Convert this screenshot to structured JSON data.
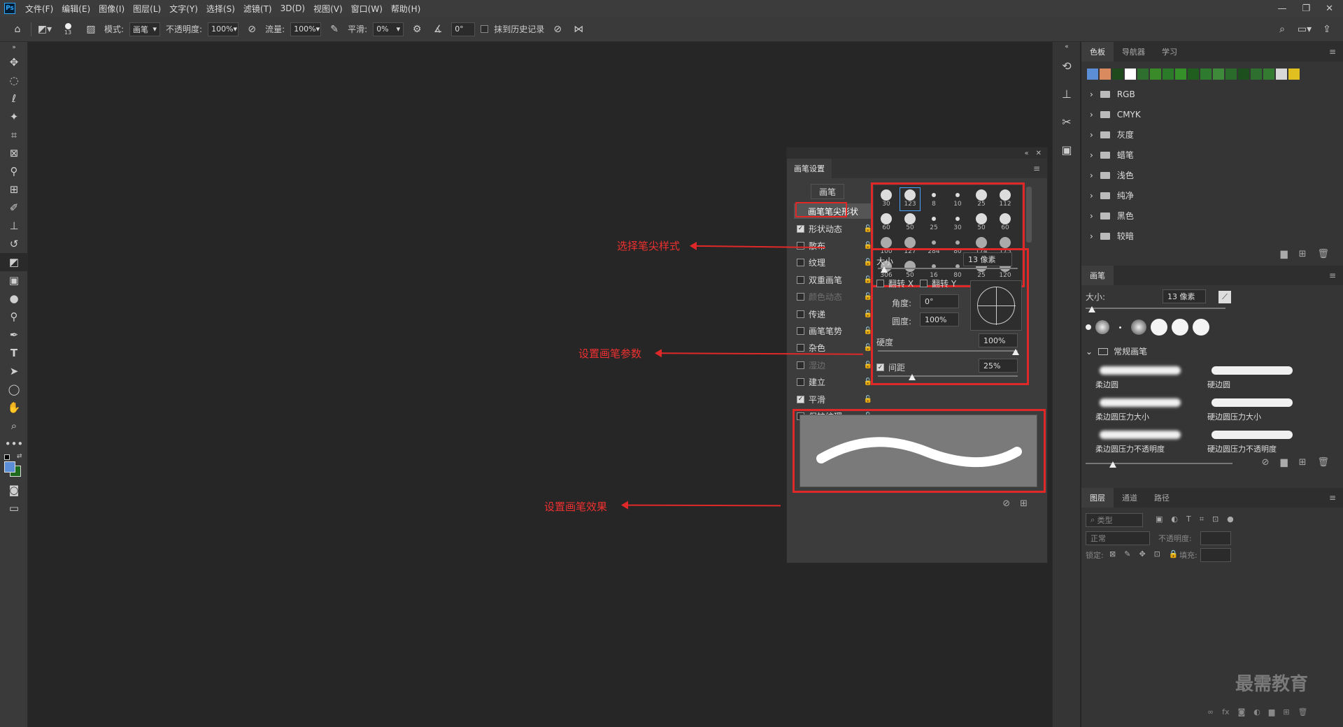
{
  "app_logo": "Ps",
  "menu": [
    "文件(F)",
    "编辑(E)",
    "图像(I)",
    "图层(L)",
    "文字(Y)",
    "选择(S)",
    "滤镜(T)",
    "3D(D)",
    "视图(V)",
    "窗口(W)",
    "帮助(H)"
  ],
  "window_controls": {
    "minimize": "—",
    "restore": "❐",
    "close": "✕"
  },
  "options": {
    "brush_size": "13",
    "mode_label": "模式:",
    "mode_value": "画笔",
    "opacity_label": "不透明度:",
    "opacity_value": "100%",
    "flow_label": "流量:",
    "flow_value": "100%",
    "smooth_label": "平滑:",
    "smooth_value": "0%",
    "angle_value": "0°",
    "erase_history_label": "抹到历史记录"
  },
  "brush_settings": {
    "tab": "画笔设置",
    "brush_button": "画笔",
    "tip_shape_label": "画笔笔尖形状",
    "options": [
      {
        "label": "形状动态",
        "checked": true,
        "dim": false
      },
      {
        "label": "散布",
        "checked": false,
        "dim": false
      },
      {
        "label": "纹理",
        "checked": false,
        "dim": false
      },
      {
        "label": "双重画笔",
        "checked": false,
        "dim": false
      },
      {
        "label": "颜色动态",
        "checked": false,
        "dim": true
      },
      {
        "label": "传递",
        "checked": false,
        "dim": false
      },
      {
        "label": "画笔笔势",
        "checked": false,
        "dim": false
      },
      {
        "label": "杂色",
        "checked": false,
        "dim": false
      },
      {
        "label": "湿边",
        "checked": false,
        "dim": true
      },
      {
        "label": "建立",
        "checked": false,
        "dim": false
      },
      {
        "label": "平滑",
        "checked": true,
        "dim": false
      },
      {
        "label": "保护纹理",
        "checked": false,
        "dim": false
      }
    ],
    "tips": [
      "30",
      "123",
      "8",
      "10",
      "25",
      "112",
      "60",
      "50",
      "25",
      "30",
      "50",
      "60",
      "100",
      "127",
      "284",
      "80",
      "174",
      "175",
      "306",
      "50",
      "16",
      "80",
      "25",
      "120"
    ],
    "size_label": "大小",
    "size_value": "13 像素",
    "flip_x_label": "翻转 X",
    "flip_y_label": "翻转 Y",
    "angle_label": "角度:",
    "angle_value": "0°",
    "roundness_label": "圆度:",
    "roundness_value": "100%",
    "hardness_label": "硬度",
    "hardness_value": "100%",
    "spacing_label": "间距",
    "spacing_value": "25%"
  },
  "annotations": {
    "tip_style": "选择笔尖样式",
    "brush_params": "设置画笔参数",
    "brush_effect": "设置画笔效果"
  },
  "swatches_panel": {
    "tabs": [
      "色板",
      "导航器",
      "学习"
    ],
    "colors": [
      "#5b8ed6",
      "#d98a5e",
      "#1e4a1e",
      "#ffffff",
      "#2e6e2e",
      "#3a8a2a",
      "#2a7a2a",
      "#35902a",
      "#1f5e1f",
      "#2e7a2e",
      "#3f8a3a",
      "#2a6a2a",
      "#1d4e1d",
      "#2e6e2e",
      "#347a30",
      "#d8d8d8",
      "#e0c020"
    ],
    "groups": [
      "RGB",
      "CMYK",
      "灰度",
      "蜡笔",
      "浅色",
      "纯净",
      "黑色",
      "较暗"
    ]
  },
  "brushes_panel": {
    "tab": "画笔",
    "size_label": "大小:",
    "size_value": "13 像素",
    "group": "常规画笔",
    "presets": [
      "柔边圆",
      "硬边圆",
      "柔边圆压力大小",
      "硬边圆压力大小",
      "柔边圆压力不透明度",
      "硬边圆压力不透明度"
    ]
  },
  "layers_panel": {
    "tabs": [
      "图层",
      "通道",
      "路径"
    ],
    "filter_placeholder": "类型",
    "blend_mode": "正常",
    "opacity_label": "不透明度:",
    "lock_label": "锁定:",
    "fill_label": "填充:"
  },
  "watermark": "最需教育"
}
